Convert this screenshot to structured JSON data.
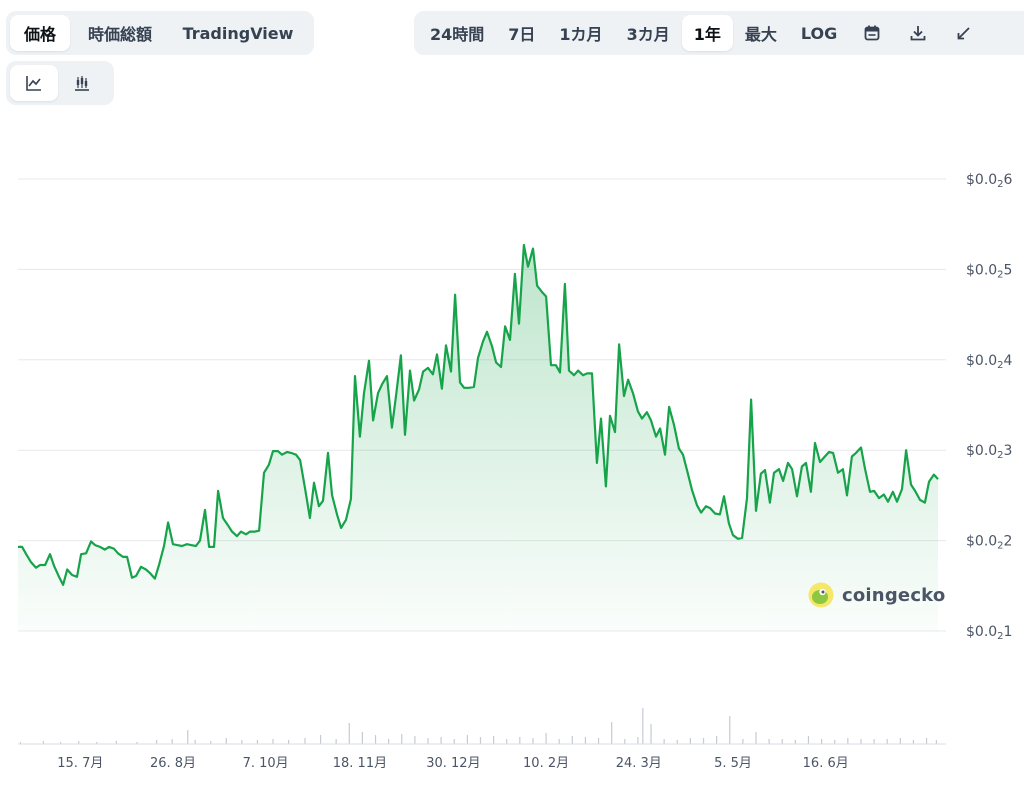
{
  "tabs": [
    {
      "label": "価格",
      "active": true
    },
    {
      "label": "時価総額",
      "active": false
    },
    {
      "label": "TradingView",
      "active": false
    }
  ],
  "ranges": [
    {
      "label": "24時間",
      "active": false
    },
    {
      "label": "7日",
      "active": false
    },
    {
      "label": "1カ月",
      "active": false
    },
    {
      "label": "3カ月",
      "active": false
    },
    {
      "label": "1年",
      "active": true
    },
    {
      "label": "最大",
      "active": false
    },
    {
      "label": "LOG",
      "active": false
    }
  ],
  "range_icons": [
    "calendar-icon",
    "download-icon",
    "expand-icon"
  ],
  "chart_types": [
    {
      "icon": "line-chart-icon",
      "active": true
    },
    {
      "icon": "candlestick-icon",
      "active": false
    }
  ],
  "watermark": {
    "text": "coingecko",
    "icon": "coingecko-logo-icon"
  },
  "colors": {
    "line": "#16a34a",
    "grid": "#e6e8ec",
    "volume": "#c5cad3"
  },
  "chart_data": {
    "type": "area",
    "ylim": [
      1,
      6
    ],
    "yticks": [
      {
        "value": 6,
        "prefix": "$0.0",
        "sub": "2",
        "digit": "6"
      },
      {
        "value": 5,
        "prefix": "$0.0",
        "sub": "2",
        "digit": "5"
      },
      {
        "value": 4,
        "prefix": "$0.0",
        "sub": "2",
        "digit": "4"
      },
      {
        "value": 3,
        "prefix": "$0.0",
        "sub": "2",
        "digit": "3"
      },
      {
        "value": 2,
        "prefix": "$0.0",
        "sub": "2",
        "digit": "2"
      },
      {
        "value": 1,
        "prefix": "$0.0",
        "sub": "2",
        "digit": "1"
      }
    ],
    "xlim": [
      0,
      100
    ],
    "xticks": [
      {
        "t": 7.6,
        "label": "15. 7月"
      },
      {
        "t": 18.9,
        "label": "26. 8月"
      },
      {
        "t": 30.2,
        "label": "7. 10月"
      },
      {
        "t": 41.7,
        "label": "18. 11月"
      },
      {
        "t": 53.1,
        "label": "30. 12月"
      },
      {
        "t": 64.4,
        "label": "10. 2月"
      },
      {
        "t": 75.7,
        "label": "24. 3月"
      },
      {
        "t": 87.2,
        "label": "5. 5月"
      },
      {
        "t": 98.5,
        "label": "16. 6月"
      }
    ],
    "series": [
      {
        "points": [
          [
            0.0,
            1.93
          ],
          [
            0.5,
            1.93
          ],
          [
            1.0,
            1.85
          ],
          [
            1.6,
            1.76
          ],
          [
            2.2,
            1.7
          ],
          [
            2.7,
            1.73
          ],
          [
            3.3,
            1.73
          ],
          [
            3.9,
            1.85
          ],
          [
            4.4,
            1.72
          ],
          [
            5.0,
            1.6
          ],
          [
            5.5,
            1.51
          ],
          [
            6.0,
            1.68
          ],
          [
            6.6,
            1.62
          ],
          [
            7.2,
            1.6
          ],
          [
            7.7,
            1.85
          ],
          [
            8.3,
            1.86
          ],
          [
            8.9,
            1.99
          ],
          [
            9.4,
            1.95
          ],
          [
            10.0,
            1.93
          ],
          [
            10.6,
            1.9
          ],
          [
            11.1,
            1.93
          ],
          [
            11.7,
            1.91
          ],
          [
            12.2,
            1.86
          ],
          [
            12.8,
            1.82
          ],
          [
            13.3,
            1.82
          ],
          [
            13.9,
            1.59
          ],
          [
            14.4,
            1.61
          ],
          [
            15.0,
            1.71
          ],
          [
            15.6,
            1.68
          ],
          [
            16.1,
            1.64
          ],
          [
            16.7,
            1.58
          ],
          [
            17.2,
            1.73
          ],
          [
            17.8,
            1.94
          ],
          [
            18.3,
            2.2
          ],
          [
            18.9,
            1.96
          ],
          [
            19.4,
            1.95
          ],
          [
            20.0,
            1.94
          ],
          [
            20.6,
            1.96
          ],
          [
            21.1,
            1.95
          ],
          [
            21.7,
            1.94
          ],
          [
            22.2,
            2.0
          ],
          [
            22.8,
            2.34
          ],
          [
            23.3,
            1.93
          ],
          [
            23.9,
            1.93
          ],
          [
            24.4,
            2.55
          ],
          [
            25.0,
            2.25
          ],
          [
            25.6,
            2.17
          ],
          [
            26.1,
            2.1
          ],
          [
            26.7,
            2.05
          ],
          [
            27.2,
            2.1
          ],
          [
            27.8,
            2.07
          ],
          [
            28.3,
            2.1
          ],
          [
            28.9,
            2.1
          ],
          [
            29.4,
            2.11
          ],
          [
            30.0,
            2.75
          ],
          [
            30.6,
            2.84
          ],
          [
            31.1,
            2.99
          ],
          [
            31.7,
            2.99
          ],
          [
            32.2,
            2.95
          ],
          [
            32.8,
            2.98
          ],
          [
            33.3,
            2.97
          ],
          [
            33.9,
            2.95
          ],
          [
            34.4,
            2.89
          ],
          [
            35.0,
            2.58
          ],
          [
            35.6,
            2.25
          ],
          [
            36.1,
            2.64
          ],
          [
            36.7,
            2.38
          ],
          [
            37.2,
            2.44
          ],
          [
            37.8,
            2.97
          ],
          [
            38.3,
            2.5
          ],
          [
            38.9,
            2.29
          ],
          [
            39.4,
            2.14
          ],
          [
            40.0,
            2.23
          ],
          [
            40.6,
            2.46
          ],
          [
            41.1,
            3.82
          ],
          [
            41.7,
            3.15
          ],
          [
            42.2,
            3.63
          ],
          [
            42.8,
            3.99
          ],
          [
            43.3,
            3.33
          ],
          [
            43.9,
            3.63
          ],
          [
            44.4,
            3.73
          ],
          [
            45.0,
            3.82
          ],
          [
            45.6,
            3.25
          ],
          [
            46.1,
            3.6
          ],
          [
            46.7,
            4.05
          ],
          [
            47.2,
            3.17
          ],
          [
            47.8,
            3.88
          ],
          [
            48.3,
            3.55
          ],
          [
            48.9,
            3.67
          ],
          [
            49.4,
            3.87
          ],
          [
            50.0,
            3.91
          ],
          [
            50.6,
            3.84
          ],
          [
            51.1,
            4.06
          ],
          [
            51.7,
            3.68
          ],
          [
            52.2,
            4.16
          ],
          [
            52.8,
            3.87
          ],
          [
            53.3,
            4.72
          ],
          [
            53.9,
            3.75
          ],
          [
            54.4,
            3.69
          ],
          [
            55.0,
            3.69
          ],
          [
            55.6,
            3.7
          ],
          [
            56.1,
            4.02
          ],
          [
            56.7,
            4.2
          ],
          [
            57.2,
            4.31
          ],
          [
            57.8,
            4.15
          ],
          [
            58.3,
            3.97
          ],
          [
            58.9,
            3.92
          ],
          [
            59.4,
            4.37
          ],
          [
            60.0,
            4.22
          ],
          [
            60.6,
            4.95
          ],
          [
            61.1,
            4.4
          ],
          [
            61.7,
            5.27
          ],
          [
            62.2,
            5.03
          ],
          [
            62.8,
            5.23
          ],
          [
            63.3,
            4.82
          ],
          [
            63.9,
            4.75
          ],
          [
            64.4,
            4.7
          ],
          [
            65.0,
            3.94
          ],
          [
            65.6,
            3.94
          ],
          [
            66.1,
            3.86
          ],
          [
            66.7,
            4.84
          ],
          [
            67.2,
            3.88
          ],
          [
            67.8,
            3.83
          ],
          [
            68.3,
            3.88
          ],
          [
            68.9,
            3.83
          ],
          [
            69.4,
            3.85
          ],
          [
            70.0,
            3.85
          ],
          [
            70.6,
            2.86
          ],
          [
            71.1,
            3.35
          ],
          [
            71.7,
            2.6
          ],
          [
            72.2,
            3.38
          ],
          [
            72.8,
            3.2
          ],
          [
            73.3,
            4.17
          ],
          [
            73.9,
            3.6
          ],
          [
            74.4,
            3.78
          ],
          [
            75.0,
            3.63
          ],
          [
            75.6,
            3.43
          ],
          [
            76.1,
            3.35
          ],
          [
            76.7,
            3.42
          ],
          [
            77.2,
            3.33
          ],
          [
            77.8,
            3.15
          ],
          [
            78.3,
            3.24
          ],
          [
            78.9,
            2.95
          ],
          [
            79.4,
            3.48
          ],
          [
            80.0,
            3.28
          ],
          [
            80.6,
            3.02
          ],
          [
            81.1,
            2.95
          ],
          [
            81.7,
            2.74
          ],
          [
            82.2,
            2.56
          ],
          [
            82.8,
            2.39
          ],
          [
            83.3,
            2.31
          ],
          [
            83.9,
            2.38
          ],
          [
            84.4,
            2.36
          ],
          [
            85.0,
            2.3
          ],
          [
            85.6,
            2.29
          ],
          [
            86.1,
            2.49
          ],
          [
            86.7,
            2.19
          ],
          [
            87.2,
            2.06
          ],
          [
            87.8,
            2.02
          ],
          [
            88.3,
            2.03
          ],
          [
            88.9,
            2.47
          ],
          [
            89.4,
            3.56
          ],
          [
            90.0,
            2.33
          ],
          [
            90.6,
            2.74
          ],
          [
            91.1,
            2.78
          ],
          [
            91.7,
            2.42
          ],
          [
            92.2,
            2.75
          ],
          [
            92.8,
            2.79
          ],
          [
            93.3,
            2.66
          ],
          [
            93.9,
            2.86
          ],
          [
            94.4,
            2.79
          ],
          [
            95.0,
            2.49
          ],
          [
            95.6,
            2.82
          ],
          [
            96.1,
            2.86
          ],
          [
            96.7,
            2.54
          ],
          [
            97.2,
            3.08
          ],
          [
            97.8,
            2.87
          ],
          [
            98.3,
            2.92
          ],
          [
            98.9,
            2.98
          ],
          [
            99.4,
            2.97
          ],
          [
            100.0,
            2.75
          ],
          [
            100.6,
            2.79
          ],
          [
            101.1,
            2.5
          ],
          [
            101.7,
            2.93
          ],
          [
            102.2,
            2.97
          ],
          [
            102.8,
            3.03
          ],
          [
            103.3,
            2.79
          ],
          [
            103.9,
            2.54
          ],
          [
            104.4,
            2.55
          ],
          [
            105.0,
            2.47
          ],
          [
            105.6,
            2.51
          ],
          [
            106.1,
            2.43
          ],
          [
            106.7,
            2.54
          ],
          [
            107.2,
            2.43
          ],
          [
            107.8,
            2.57
          ],
          [
            108.3,
            3.0
          ],
          [
            108.9,
            2.62
          ],
          [
            109.4,
            2.55
          ],
          [
            110.0,
            2.45
          ],
          [
            110.6,
            2.42
          ],
          [
            111.1,
            2.65
          ],
          [
            111.7,
            2.73
          ],
          [
            112.2,
            2.68
          ]
        ]
      }
    ],
    "volume": {
      "points": [
        [
          0.3,
          0.02
        ],
        [
          3.1,
          0.03
        ],
        [
          5.2,
          0.02
        ],
        [
          7.4,
          0.03
        ],
        [
          9.6,
          0.02
        ],
        [
          12.0,
          0.03
        ],
        [
          14.5,
          0.02
        ],
        [
          16.9,
          0.04
        ],
        [
          18.8,
          0.05
        ],
        [
          20.7,
          0.14
        ],
        [
          21.6,
          0.04
        ],
        [
          23.5,
          0.03
        ],
        [
          25.4,
          0.06
        ],
        [
          27.3,
          0.04
        ],
        [
          29.2,
          0.04
        ],
        [
          31.1,
          0.05
        ],
        [
          33.0,
          0.04
        ],
        [
          35.0,
          0.06
        ],
        [
          36.9,
          0.09
        ],
        [
          38.8,
          0.05
        ],
        [
          40.4,
          0.21
        ],
        [
          42.0,
          0.12
        ],
        [
          43.6,
          0.09
        ],
        [
          45.2,
          0.05
        ],
        [
          46.8,
          0.1
        ],
        [
          48.4,
          0.08
        ],
        [
          50.0,
          0.06
        ],
        [
          51.6,
          0.07
        ],
        [
          53.2,
          0.05
        ],
        [
          54.8,
          0.09
        ],
        [
          56.4,
          0.07
        ],
        [
          58.0,
          0.08
        ],
        [
          59.6,
          0.05
        ],
        [
          61.2,
          0.07
        ],
        [
          62.8,
          0.06
        ],
        [
          64.4,
          0.11
        ],
        [
          66.0,
          0.05
        ],
        [
          67.6,
          0.08
        ],
        [
          69.2,
          0.07
        ],
        [
          70.8,
          0.06
        ],
        [
          72.4,
          0.22
        ],
        [
          74.0,
          0.05
        ],
        [
          75.6,
          0.07
        ],
        [
          76.2,
          0.36
        ],
        [
          77.2,
          0.2
        ],
        [
          78.8,
          0.05
        ],
        [
          80.4,
          0.04
        ],
        [
          82.0,
          0.06
        ],
        [
          83.6,
          0.06
        ],
        [
          85.2,
          0.08
        ],
        [
          86.8,
          0.28
        ],
        [
          88.4,
          0.05
        ],
        [
          90.0,
          0.12
        ],
        [
          91.6,
          0.05
        ],
        [
          93.2,
          0.05
        ],
        [
          94.8,
          0.04
        ],
        [
          96.4,
          0.08
        ],
        [
          98.0,
          0.05
        ],
        [
          99.6,
          0.04
        ],
        [
          101.2,
          0.06
        ],
        [
          102.8,
          0.05
        ],
        [
          104.4,
          0.05
        ],
        [
          106.0,
          0.05
        ],
        [
          107.6,
          0.06
        ],
        [
          109.2,
          0.04
        ],
        [
          110.8,
          0.06
        ],
        [
          112.0,
          0.04
        ]
      ]
    }
  }
}
